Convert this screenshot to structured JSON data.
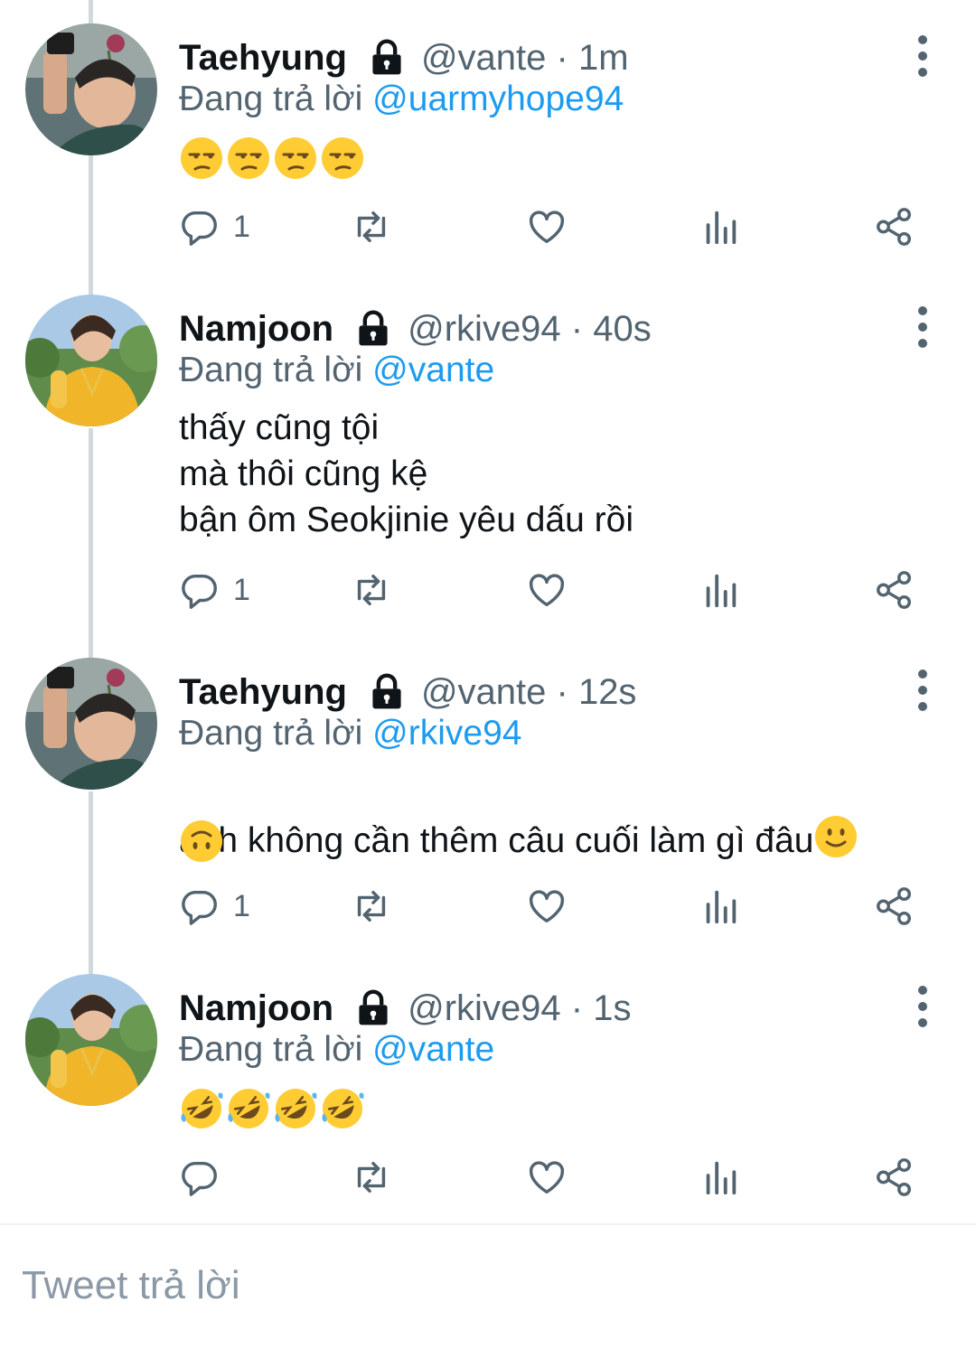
{
  "tweets": [
    {
      "name": "Taehyung",
      "handle_meta": "@vante · 1m",
      "replying_prefix": "Đang trả lời ",
      "replying_to": "@uarmyhope94",
      "text": "",
      "emoji": [
        "unamused",
        "unamused",
        "unamused",
        "unamused"
      ],
      "reply_count": "1",
      "avatar": "taehyung-avatar"
    },
    {
      "name": "Namjoon",
      "handle_meta": "@rkive94 · 40s",
      "replying_prefix": "Đang trả lời ",
      "replying_to": "@vante",
      "text": "thấy cũng tội\nmà thôi cũng kệ\nbận ôm Seokjinie yêu dấu rồi",
      "emoji": [],
      "reply_count": "1",
      "avatar": "namjoon-avatar"
    },
    {
      "name": "Taehyung",
      "handle_meta": "@vante · 12s",
      "replying_prefix": "Đang trả lời ",
      "replying_to": "@rkive94",
      "text": "anh không cần thêm câu cuối làm gì đâu",
      "emoji": [
        "slightly-smiling",
        "upside-down"
      ],
      "reply_count": "1",
      "avatar": "taehyung-avatar"
    },
    {
      "name": "Namjoon",
      "handle_meta": "@rkive94 · 1s",
      "replying_prefix": "Đang trả lời ",
      "replying_to": "@vante",
      "text": "",
      "emoji": [
        "rofl",
        "rofl",
        "rofl",
        "rofl"
      ],
      "reply_count": "",
      "avatar": "namjoon-avatar"
    }
  ],
  "icons": {
    "reply": "reply-icon",
    "retweet": "retweet-icon",
    "like": "like-icon",
    "views": "views-icon",
    "share": "share-icon",
    "lock": "lock-icon",
    "more": "more-options-icon"
  },
  "colors": {
    "mention": "#1d9bf0",
    "secondary_text": "#536471",
    "thread_line": "#cfd9de"
  },
  "composer": {
    "placeholder": "Tweet trả lời"
  }
}
